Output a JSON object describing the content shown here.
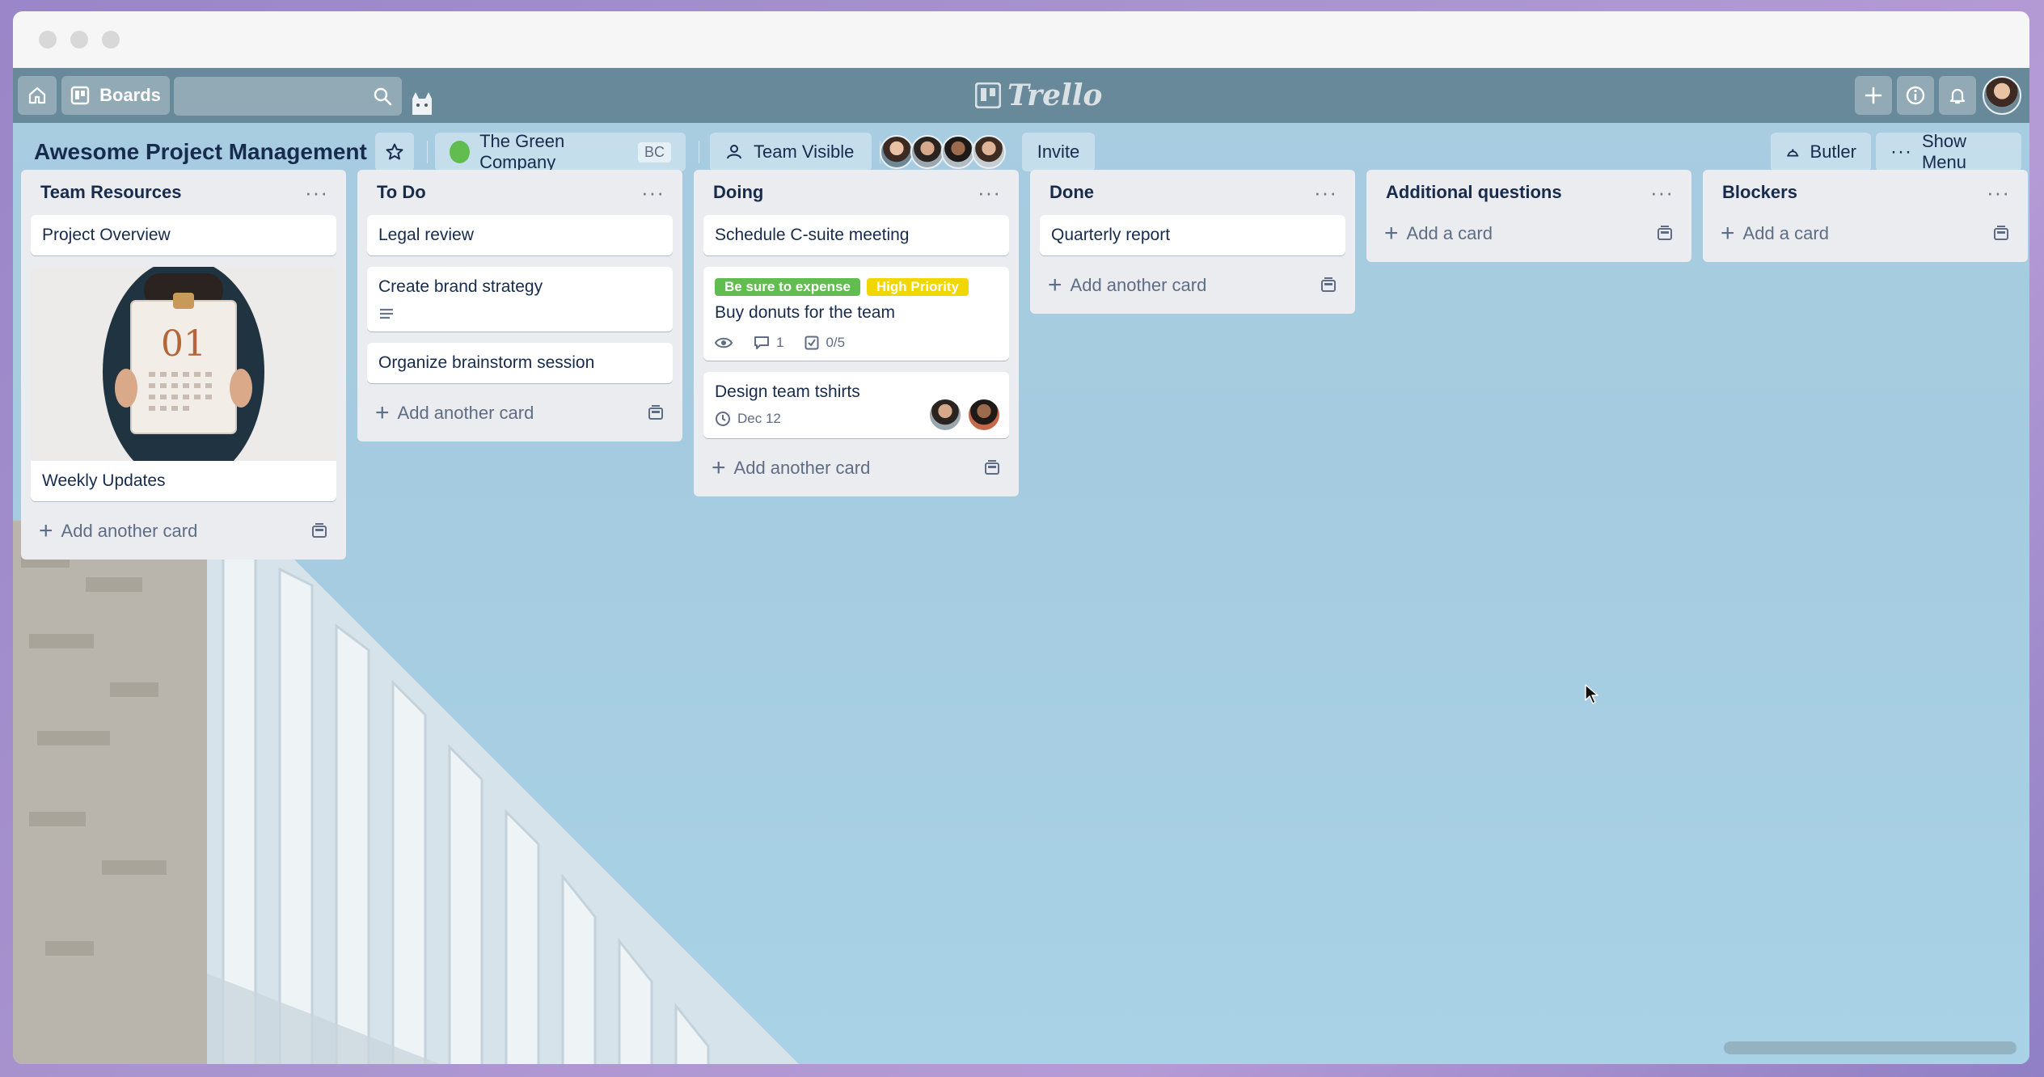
{
  "window": {
    "controls": [
      "close",
      "minimize",
      "maximize"
    ]
  },
  "topnav": {
    "boards_label": "Boards",
    "logo_text": "Trello",
    "icons": [
      "home-icon",
      "boards-icon",
      "search-icon",
      "plus-icon",
      "info-icon",
      "bell-icon"
    ]
  },
  "board": {
    "title": "Awesome Project Management",
    "team_name": "The Green Company",
    "team_badge": "BC",
    "visibility": "Team Visible",
    "invite_label": "Invite",
    "butler_label": "Butler",
    "menu_label": "Show Menu"
  },
  "lists": [
    {
      "title": "Team Resources",
      "cards": [
        {
          "title": "Project Overview"
        },
        {
          "title": "Weekly Updates",
          "cover": "calendar-photo"
        }
      ],
      "add_label": "Add another card"
    },
    {
      "title": "To Do",
      "cards": [
        {
          "title": "Legal review"
        },
        {
          "title": "Create brand strategy",
          "has_description": true
        },
        {
          "title": "Organize brainstorm session"
        }
      ],
      "add_label": "Add another card"
    },
    {
      "title": "Doing",
      "cards": [
        {
          "title": "Schedule C-suite meeting"
        },
        {
          "title": "Buy donuts for the team",
          "labels": [
            {
              "text": "Be sure to expense",
              "color": "#61bd4f"
            },
            {
              "text": "High Priority",
              "color": "#f2d600"
            }
          ],
          "comments": "1",
          "checklist": "0/5"
        },
        {
          "title": "Design team tshirts",
          "due": "Dec 12"
        }
      ],
      "add_label": "Add another card"
    },
    {
      "title": "Done",
      "cards": [
        {
          "title": "Quarterly report"
        }
      ],
      "add_label": "Add another card"
    },
    {
      "title": "Additional questions",
      "cards": [],
      "add_label": "Add a card"
    },
    {
      "title": "Blockers",
      "cards": [],
      "add_label": "Add a card"
    }
  ],
  "colors": {
    "header_bg": "#5c7c8c",
    "list_bg": "#ebecf0",
    "label_green": "#61bd4f",
    "label_yellow": "#f2d600",
    "text_primary": "#172b4d",
    "text_secondary": "#5e6c84"
  }
}
